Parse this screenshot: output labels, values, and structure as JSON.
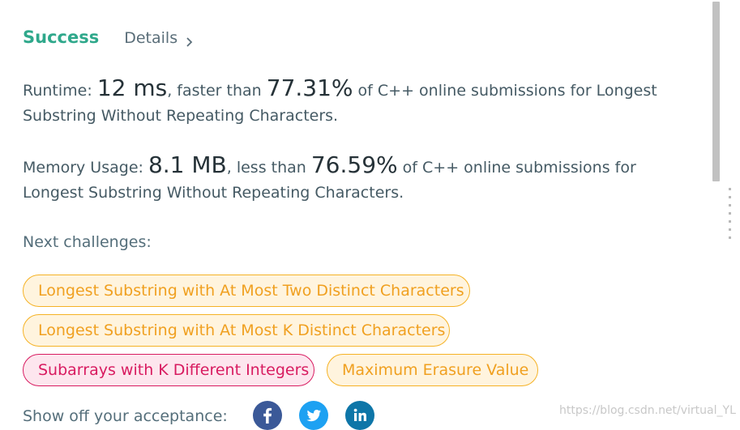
{
  "status": {
    "result": "Success",
    "details_label": "Details"
  },
  "runtime": {
    "label": "Runtime: ",
    "value": "12 ms",
    "comparison": ", faster than ",
    "percent": "77.31%",
    "suffix": " of C++ online submissions for Longest Substring Without Repeating Characters."
  },
  "memory": {
    "label": "Memory Usage: ",
    "value": "8.1 MB",
    "comparison": ", less than ",
    "percent": "76.59%",
    "suffix": " of C++ online submissions for Longest Substring Without Repeating Characters."
  },
  "next_challenges": {
    "label": "Next challenges:",
    "items": [
      {
        "title": "Longest Substring with At Most Two Distinct Characters",
        "difficulty": "medium"
      },
      {
        "title": "Longest Substring with At Most K Distinct Characters",
        "difficulty": "medium"
      },
      {
        "title": "Subarrays with K Different Integers",
        "difficulty": "hard"
      },
      {
        "title": "Maximum Erasure Value",
        "difficulty": "medium"
      }
    ]
  },
  "share": {
    "label": "Show off your acceptance:",
    "icons": [
      "facebook-icon",
      "twitter-icon",
      "linkedin-icon"
    ]
  },
  "watermark": "https://blog.csdn.net/virtual_YL",
  "colors": {
    "success": "#2fa88b",
    "medium_text": "#f0a020",
    "medium_border": "#f5b225",
    "medium_bg": "#fff4de",
    "hard_text": "#d81b60",
    "hard_bg": "#fde6ee",
    "facebook": "#3b5998",
    "twitter": "#1da1f2",
    "linkedin": "#0e76a8"
  }
}
